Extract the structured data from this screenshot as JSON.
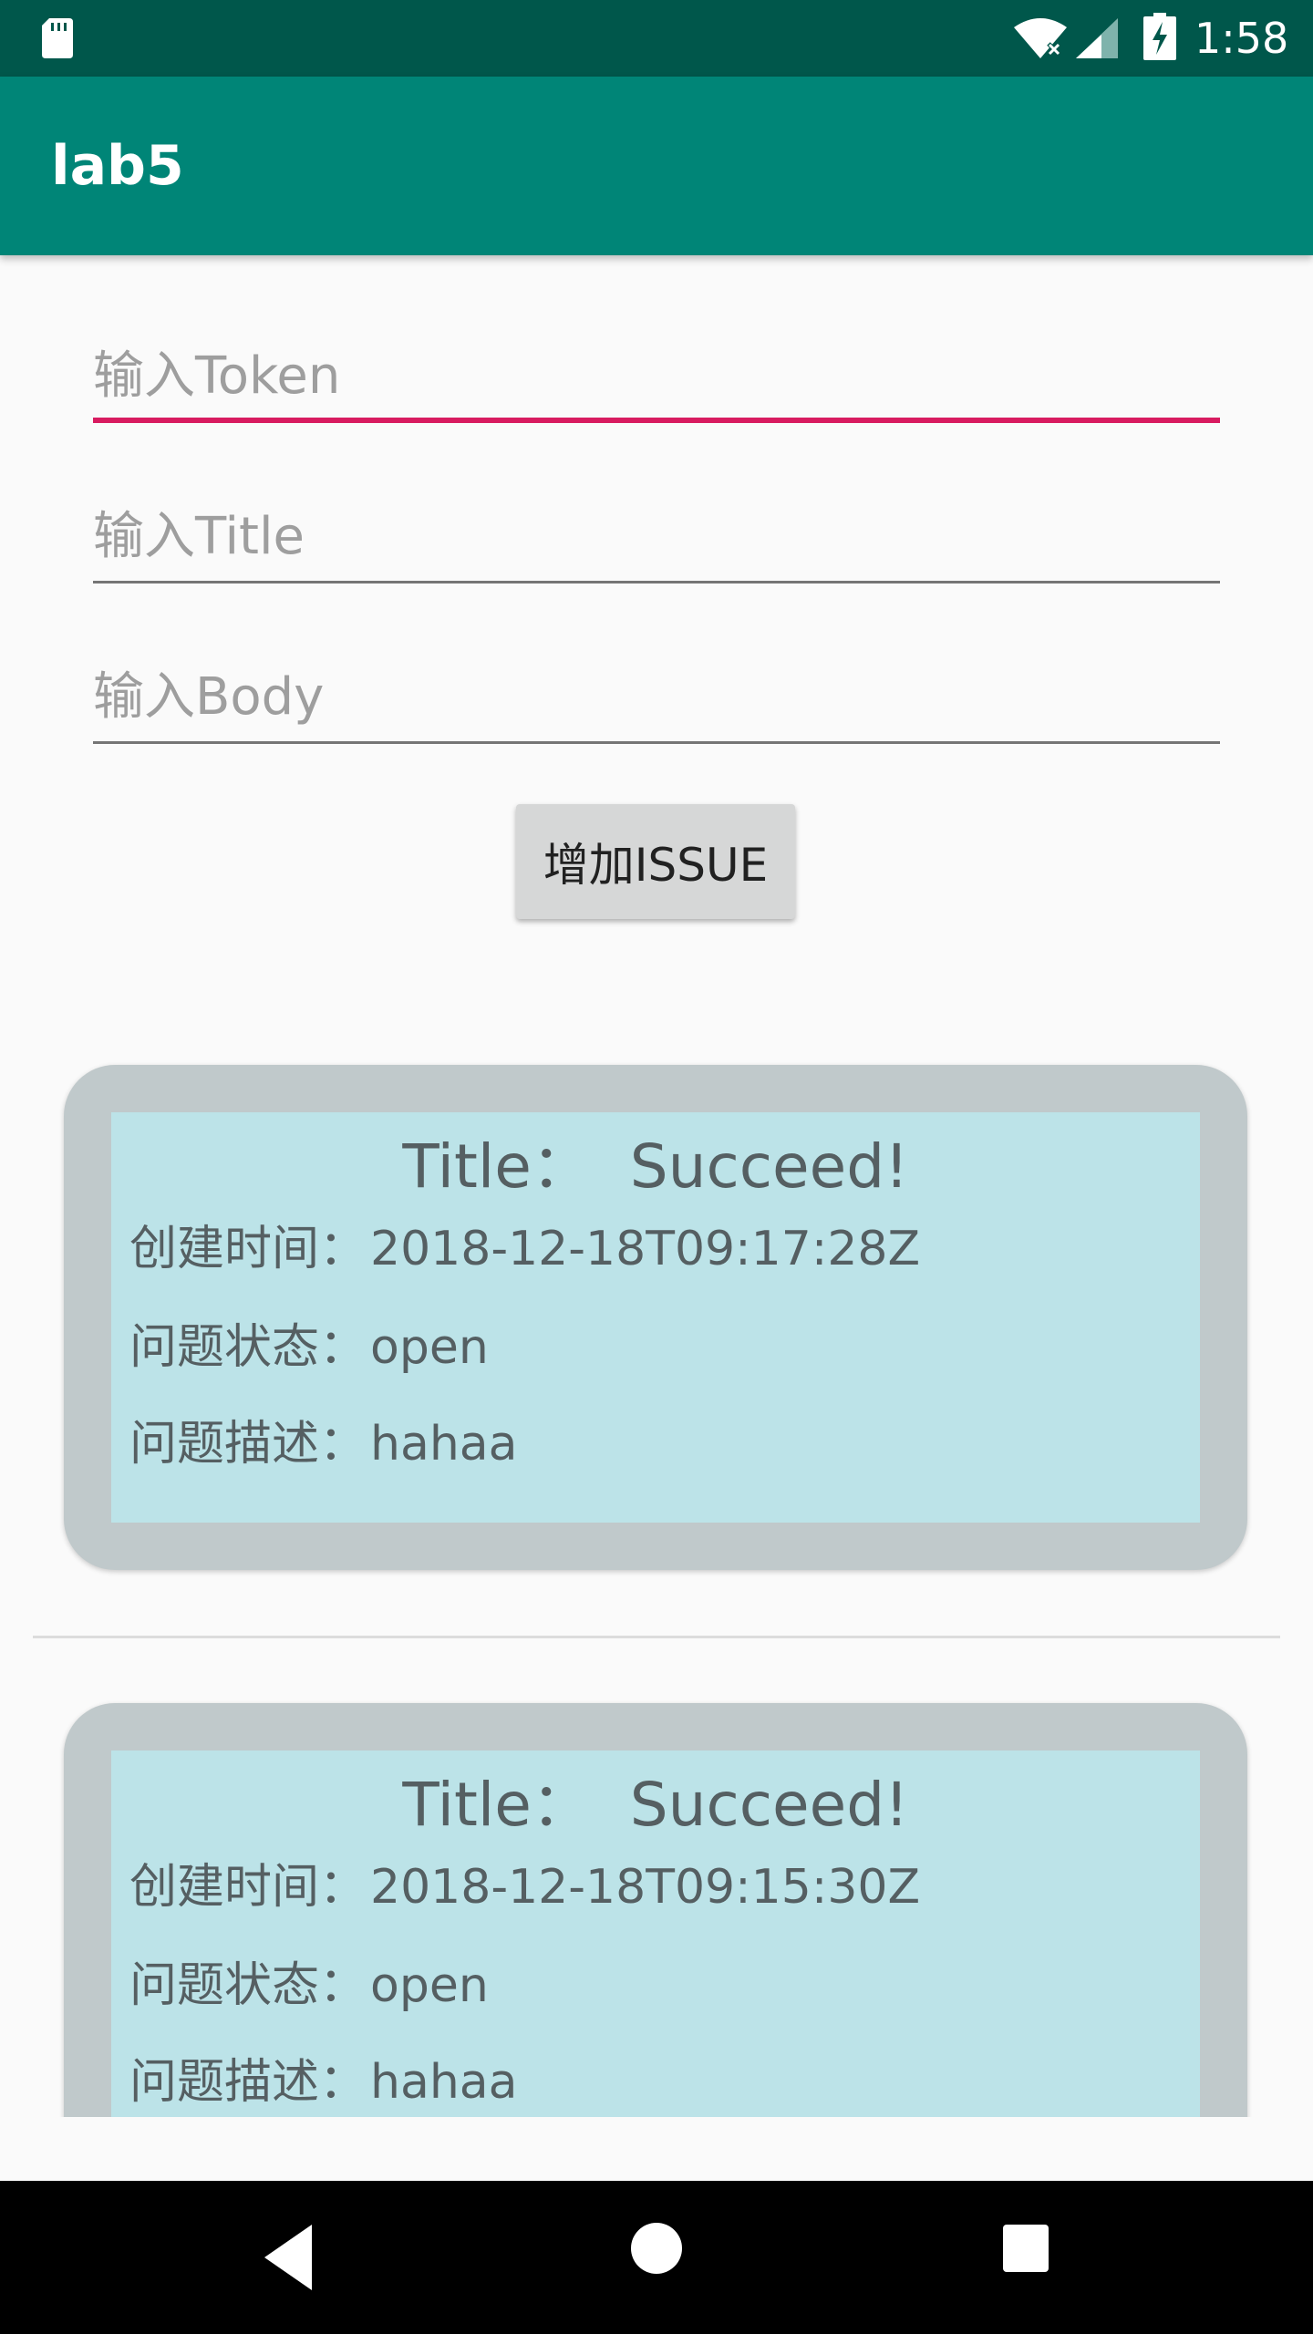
{
  "status_bar": {
    "time": "1:58",
    "icons": [
      "sd-card-icon",
      "wifi-icon",
      "signal-icon",
      "battery-charging-icon"
    ]
  },
  "app_bar": {
    "title": "lab5"
  },
  "form": {
    "token_placeholder": "输入Token",
    "title_placeholder": "输入Title",
    "body_placeholder": "输入Body",
    "token_value": "",
    "title_value": "",
    "body_value": "",
    "add_button_label": "增加ISSUE"
  },
  "colors": {
    "status_bar": "#00574b",
    "app_bar": "#008577",
    "accent": "#d81b60",
    "card_outer": "#c0c9cb",
    "card_inner": "#bce3e8"
  },
  "issues": [
    {
      "title": "Title：  Succeed!",
      "created_label": "创建时间：",
      "created_value": "2018-12-18T09:17:28Z",
      "state_label": "问题状态：",
      "state_value": "open",
      "desc_label": "问题描述：",
      "desc_value": "hahaa"
    },
    {
      "title": "Title：  Succeed!",
      "created_label": "创建时间：",
      "created_value": "2018-12-18T09:15:30Z",
      "state_label": "问题状态：",
      "state_value": "open",
      "desc_label": "问题描述：",
      "desc_value": "hahaa"
    }
  ],
  "nav_bar": {
    "icons": [
      "back-icon",
      "home-icon",
      "recents-icon"
    ]
  }
}
